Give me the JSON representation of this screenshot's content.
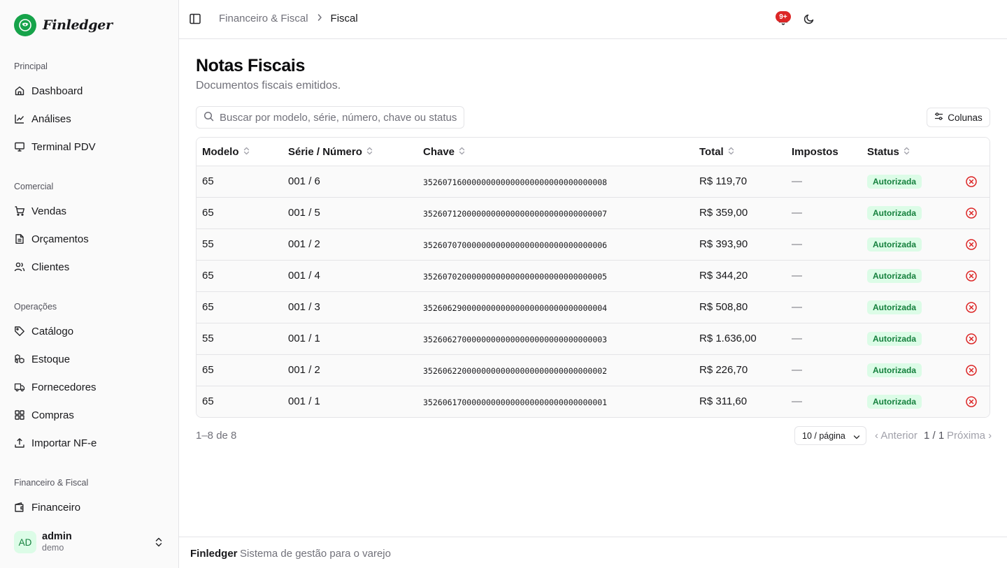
{
  "brand": {
    "name": "Finledger"
  },
  "sidebar": {
    "groups": [
      {
        "label": "Principal",
        "items": [
          {
            "label": "Dashboard",
            "icon": "home-icon"
          },
          {
            "label": "Análises",
            "icon": "line-chart-icon"
          },
          {
            "label": "Terminal PDV",
            "icon": "monitor-icon"
          }
        ]
      },
      {
        "label": "Comercial",
        "items": [
          {
            "label": "Vendas",
            "icon": "cart-icon"
          },
          {
            "label": "Orçamentos",
            "icon": "document-icon"
          },
          {
            "label": "Clientes",
            "icon": "users-icon"
          }
        ]
      },
      {
        "label": "Operações",
        "items": [
          {
            "label": "Catálogo",
            "icon": "tag-icon"
          },
          {
            "label": "Estoque",
            "icon": "boxes-icon"
          },
          {
            "label": "Fornecedores",
            "icon": "truck-icon"
          },
          {
            "label": "Compras",
            "icon": "grid-icon"
          },
          {
            "label": "Importar NF-e",
            "icon": "upload-icon"
          }
        ]
      },
      {
        "label": "Financeiro & Fiscal",
        "items": [
          {
            "label": "Financeiro",
            "icon": "wallet-icon"
          }
        ]
      }
    ],
    "user": {
      "initials": "AD",
      "name": "admin",
      "org": "demo"
    }
  },
  "header": {
    "breadcrumb": [
      "Financeiro & Fiscal",
      "Fiscal"
    ],
    "notifications_badge": "9+"
  },
  "page": {
    "title": "Notas Fiscais",
    "subtitle": "Documentos fiscais emitidos."
  },
  "search": {
    "placeholder": "Buscar por modelo, série, número, chave ou status",
    "value": ""
  },
  "columns_button": "Colunas",
  "table": {
    "headers": {
      "modelo": "Modelo",
      "serie": "Série / Número",
      "chave": "Chave",
      "total": "Total",
      "impostos": "Impostos",
      "status": "Status"
    },
    "rows": [
      {
        "modelo": "65",
        "serie": "001 / 6",
        "chave": "35260716000000000000000000000000000008",
        "total": "R$ 119,70",
        "impostos": "—",
        "status": "Autorizada"
      },
      {
        "modelo": "65",
        "serie": "001 / 5",
        "chave": "35260712000000000000000000000000000007",
        "total": "R$ 359,00",
        "impostos": "—",
        "status": "Autorizada"
      },
      {
        "modelo": "55",
        "serie": "001 / 2",
        "chave": "35260707000000000000000000000000000006",
        "total": "R$ 393,90",
        "impostos": "—",
        "status": "Autorizada"
      },
      {
        "modelo": "65",
        "serie": "001 / 4",
        "chave": "35260702000000000000000000000000000005",
        "total": "R$ 344,20",
        "impostos": "—",
        "status": "Autorizada"
      },
      {
        "modelo": "65",
        "serie": "001 / 3",
        "chave": "35260629000000000000000000000000000004",
        "total": "R$ 508,80",
        "impostos": "—",
        "status": "Autorizada"
      },
      {
        "modelo": "55",
        "serie": "001 / 1",
        "chave": "35260627000000000000000000000000000003",
        "total": "R$ 1.636,00",
        "impostos": "—",
        "status": "Autorizada"
      },
      {
        "modelo": "65",
        "serie": "001 / 2",
        "chave": "35260622000000000000000000000000000002",
        "total": "R$ 226,70",
        "impostos": "—",
        "status": "Autorizada"
      },
      {
        "modelo": "65",
        "serie": "001 / 1",
        "chave": "35260617000000000000000000000000000001",
        "total": "R$ 311,60",
        "impostos": "—",
        "status": "Autorizada"
      }
    ]
  },
  "pagination": {
    "count": "1–8 de 8",
    "page_size": "10 / página",
    "prev": "‹ Anterior",
    "current": "1 / 1",
    "next": "Próxima ›"
  },
  "footer": {
    "brand": "Finledger",
    "text": "Sistema de gestão para o varejo"
  },
  "colors": {
    "accent": "#16a34a",
    "badge_bg": "#dcfce7",
    "badge_text": "#15803d",
    "danger": "#dc2626"
  }
}
